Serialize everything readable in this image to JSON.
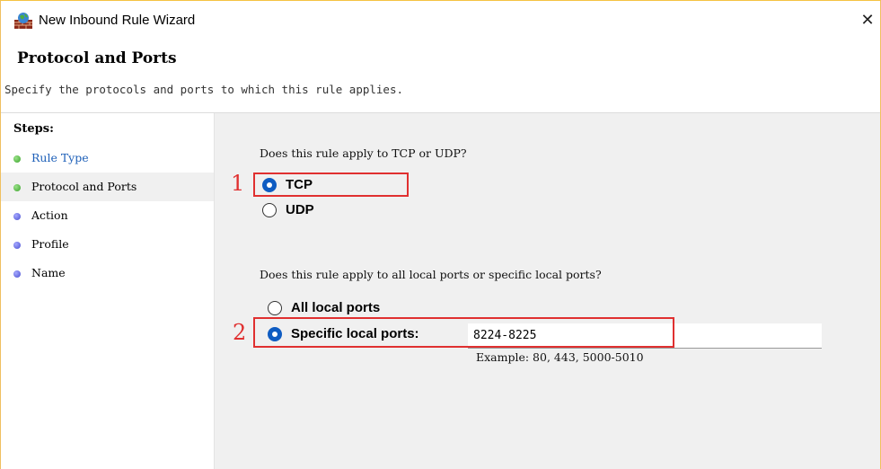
{
  "window": {
    "title": "New Inbound Rule Wizard",
    "close_glyph": "✕"
  },
  "header": {
    "title": "Protocol and Ports",
    "subtitle": "Specify the protocols and ports to which this rule applies."
  },
  "steps": {
    "label": "Steps:",
    "items": [
      {
        "label": "Rule Type",
        "state": "done"
      },
      {
        "label": "Protocol and Ports",
        "state": "current"
      },
      {
        "label": "Action",
        "state": "pending"
      },
      {
        "label": "Profile",
        "state": "pending"
      },
      {
        "label": "Name",
        "state": "pending"
      }
    ]
  },
  "protocol": {
    "question": "Does this rule apply to TCP or UDP?",
    "options": [
      {
        "label": "TCP",
        "selected": true
      },
      {
        "label": "UDP",
        "selected": false
      }
    ]
  },
  "ports": {
    "question": "Does this rule apply to all local ports or specific local ports?",
    "options": [
      {
        "label": "All local ports",
        "selected": false
      },
      {
        "label": "Specific local ports:",
        "selected": true
      }
    ],
    "value": "8224-8225",
    "example": "Example: 80, 443, 5000-5010"
  },
  "annotations": {
    "one": "1",
    "two": "2",
    "color": "#e03030"
  },
  "colors": {
    "accent": "#0f5cc2",
    "link": "#1d5fb8",
    "done_dot": "#3aa32a",
    "pending_dot": "#4a4fd0"
  },
  "icons": {
    "app": "firewall-icon",
    "close": "close-icon"
  }
}
